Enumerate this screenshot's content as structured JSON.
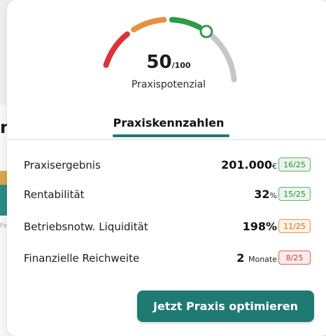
{
  "gauge": {
    "score": "50",
    "max": "/100",
    "label": "Praxispotenzial",
    "level": 0.5,
    "colors": {
      "red": "#d8343a",
      "orange": "#e8913b",
      "green": "#2c9c4a",
      "gray": "#c6c6c6",
      "marker": "#2c9c4a"
    }
  },
  "section": {
    "title": "Praxiskennzahlen"
  },
  "metrics": [
    {
      "label": "Praxisergebnis",
      "value": "201.000",
      "unit": "€",
      "badge": "16/25",
      "status": "green"
    },
    {
      "label": "Rentabilität",
      "value": "32",
      "unit": "%",
      "badge": "15/25",
      "status": "green"
    },
    {
      "label": "Betriebsnotw. Liquidität",
      "value": "198%",
      "unit": "",
      "badge": "11/25",
      "status": "orange"
    },
    {
      "label": "Finanzielle Reichweite",
      "value": "2",
      "unit": "Monate",
      "badge": "8/25",
      "status": "red"
    }
  ],
  "cta": {
    "label": "Jetzt Praxis optimieren"
  },
  "background": {
    "heading_fragment": "n",
    "caption_fragment": "Fe"
  },
  "accent": "#1f7a73"
}
